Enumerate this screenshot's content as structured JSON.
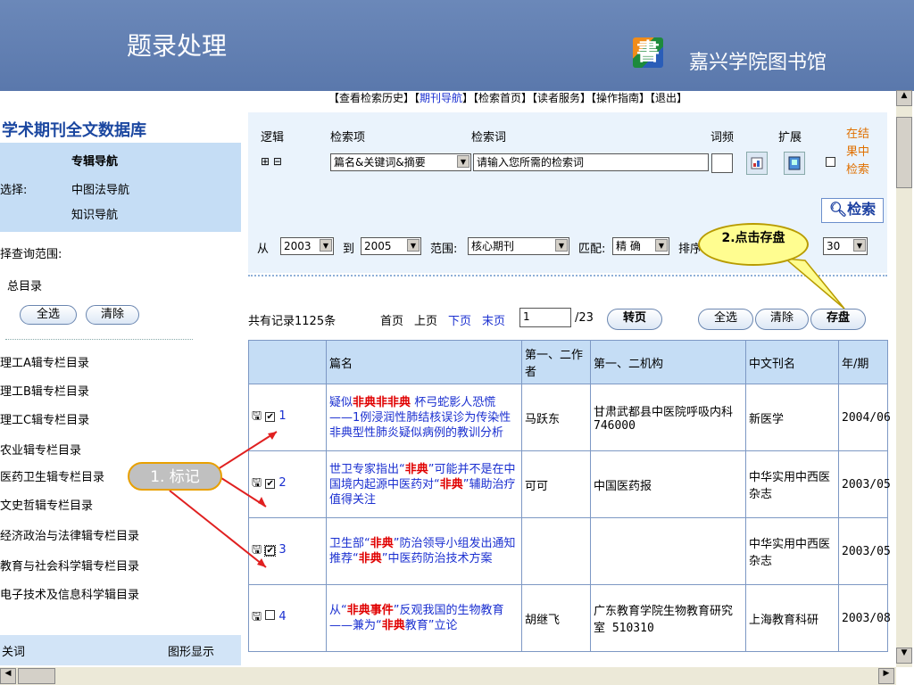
{
  "header": {
    "title": "题录处理",
    "library_name": "嘉兴学院图书馆",
    "logo_glyph": "書"
  },
  "left": {
    "db_title": "学术期刊全文数据库",
    "nav_heading": "专辑导航",
    "select_label": "选择:",
    "nav_links": [
      "中图法导航",
      "知识导航"
    ],
    "scope_label": "择查询范围:",
    "catalog_label": "总目录",
    "select_all": "全选",
    "clear": "清除",
    "catalog_items": [
      "理工A辑专栏目录",
      "理工B辑专栏目录",
      "理工C辑专栏目录",
      "农业辑专栏目录",
      "医药卫生辑专栏目录",
      "文史哲辑专栏目录",
      "经济政治与法律辑专栏目录",
      "教育与社会科学辑专栏目录",
      "电子技术及信息科学辑目录"
    ],
    "keyword_label": "关词",
    "graph_label": "图形显示"
  },
  "top_nav": {
    "prefix": "【查看检索历史】【",
    "journal_nav": "期刊导航",
    "suffix": "】【检索首页】【读者服务】【操作指南】【退出】"
  },
  "search": {
    "logic_label": "逻辑",
    "field_label": "检索项",
    "term_label": "检索词",
    "freq_label": "词频",
    "expand_label": "扩展",
    "in_result_label": "在结果中检索",
    "plus_minus": "⊞ ⊟",
    "field_value": "篇名&关键词&摘要",
    "term_placeholder": "请输入您所需的检索词",
    "search_button": "检索",
    "from_label": "从",
    "year_from": "2003",
    "to_label": "到",
    "year_to": "2005",
    "range_label": "范围:",
    "range_value": "核心期刊",
    "match_label": "匹配:",
    "match_value": "精 确",
    "sort_label": "排序",
    "per_page_value": "30"
  },
  "results_bar": {
    "total": "共有记录1125条",
    "first": "首页",
    "prev": "上页",
    "next": "下页",
    "last": "末页",
    "page_value": "1",
    "page_total": "/23",
    "goto": "转页",
    "select_all": "全选",
    "clear": "清除",
    "save": "存盘"
  },
  "table": {
    "headers": [
      "篇名",
      "第一、二作者",
      "第一、二机构",
      "中文刊名",
      "年/期"
    ],
    "rows": [
      {
        "num": "1",
        "title_parts": [
          "疑似",
          "非典",
          "非",
          "非典",
          " 杯弓蛇影人恐慌——1例浸润性肺结核误诊为传染性非典型性肺炎疑似病例的教训分析"
        ],
        "author": "马跃东",
        "org": "甘肃武都县中医院呼吸内科 746000",
        "journal": "新医学",
        "issue": "2004/06"
      },
      {
        "num": "2",
        "title_parts": [
          "世卫专家指出“",
          "非典",
          "”可能并不是在中国境内起源中医药对“",
          "非典",
          "”辅助治疗值得关注"
        ],
        "author": "可可",
        "org": "中国医药报",
        "journal": "中华实用中西医杂志",
        "issue": "2003/05"
      },
      {
        "num": "3",
        "title_parts": [
          "卫生部“",
          "非典",
          "”防治领导小组发出通知推荐“",
          "非典",
          "”中医药防治技术方案"
        ],
        "author": "",
        "org": "",
        "journal": "中华实用中西医杂志",
        "issue": "2003/05"
      },
      {
        "num": "4",
        "title_parts": [
          "从“",
          "非典事件",
          "”反观我国的生物教育——兼为“",
          "非典",
          "教育”立论"
        ],
        "author": "胡继飞",
        "org": "广东教育学院生物教育研究室 510310",
        "journal": "上海教育科研",
        "issue": "2003/08"
      }
    ]
  },
  "callouts": {
    "mark": "1. 标记",
    "save": "2.点击存盘"
  },
  "colors": {
    "header_bg": "#5a78ac",
    "nav_bg": "#c5ddf5",
    "link_blue": "#1a2fd0",
    "highlight_red": "#e00000"
  }
}
